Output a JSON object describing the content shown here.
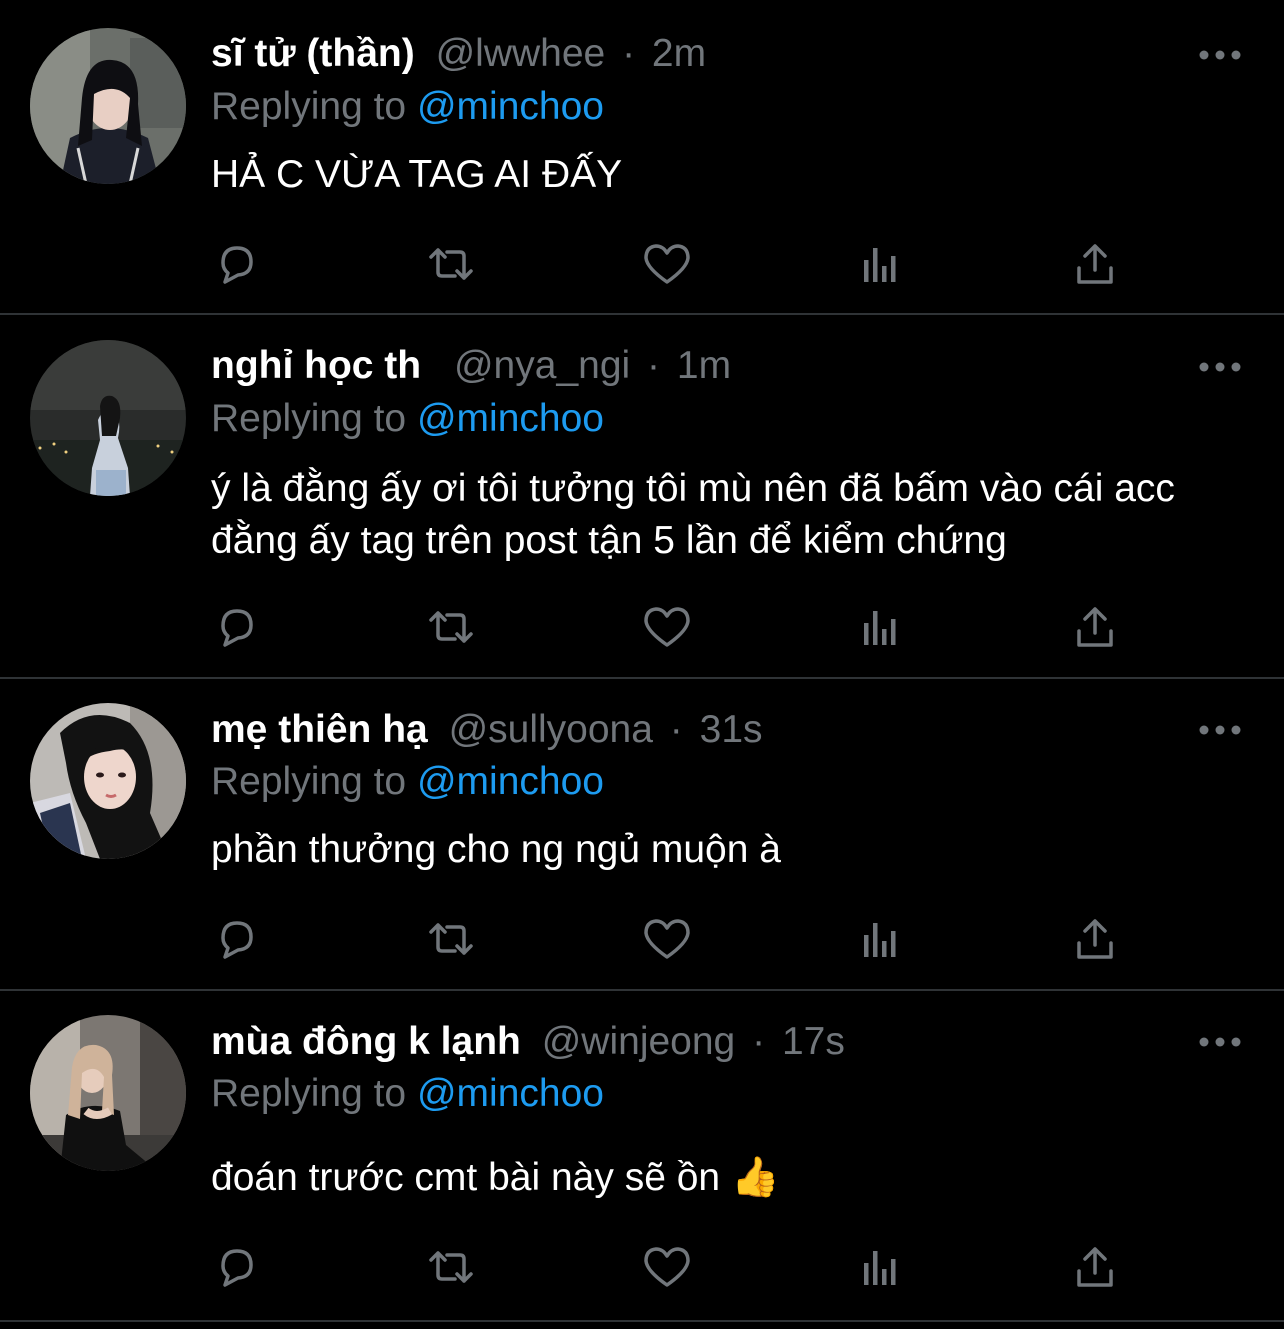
{
  "colors": {
    "background": "#000000",
    "divider": "#2f3336",
    "muted": "#71767b",
    "mention": "#1d9bf0",
    "text": "#ffffff"
  },
  "reply_prefix": "Replying to",
  "tweets": [
    {
      "display_name": "sĩ tử (thần)",
      "handle": "@lwwhee",
      "separator": "·",
      "time": "2m",
      "replying_to": "@minchoo",
      "text": "HẢ C VỪA TAG AI ĐẤY",
      "icons": [
        "avatar-photo",
        "more-icon",
        "reply-icon",
        "retweet-icon",
        "like-icon",
        "analytics-icon",
        "share-icon"
      ]
    },
    {
      "display_name": "nghỉ học th",
      "handle": "@nya_ngi",
      "separator": "·",
      "time": "1m",
      "replying_to": "@minchoo",
      "text": "ý là đằng ấy ơi tôi tưởng tôi mù nên đã bấm vào cái acc đằng ấy tag trên post tận 5 lần để kiểm chứng",
      "icons": [
        "avatar-photo",
        "more-icon",
        "reply-icon",
        "retweet-icon",
        "like-icon",
        "analytics-icon",
        "share-icon"
      ]
    },
    {
      "display_name": "mẹ thiên hạ",
      "handle": "@sullyoona",
      "separator": "·",
      "time": "31s",
      "replying_to": "@minchoo",
      "text": "phần thưởng cho ng ngủ muộn à",
      "icons": [
        "avatar-photo",
        "more-icon",
        "reply-icon",
        "retweet-icon",
        "like-icon",
        "analytics-icon",
        "share-icon"
      ]
    },
    {
      "display_name": "mùa đông k lạnh",
      "handle": "@winjeong",
      "separator": "·",
      "time": "17s",
      "replying_to": "@minchoo",
      "text": "đoán trước cmt bài này sẽ ồn",
      "emoji": "👍",
      "icons": [
        "avatar-photo",
        "more-icon",
        "reply-icon",
        "retweet-icon",
        "like-icon",
        "analytics-icon",
        "share-icon"
      ]
    }
  ]
}
